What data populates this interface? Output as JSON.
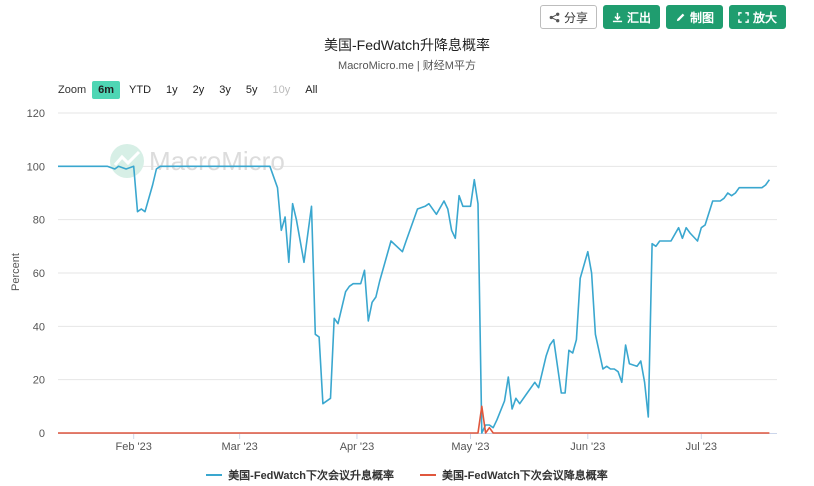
{
  "toolbar": {
    "buttons": [
      {
        "label": "分享",
        "icon": "share-icon"
      },
      {
        "label": "汇出",
        "icon": "download-icon"
      },
      {
        "label": "制图",
        "icon": "pencil-icon"
      },
      {
        "label": "放大",
        "icon": "expand-icon"
      }
    ]
  },
  "zoom": {
    "label": "Zoom",
    "options": [
      "6m",
      "YTD",
      "1y",
      "2y",
      "3y",
      "5y",
      "10y",
      "All"
    ],
    "selected": "6m",
    "disabled": [
      "10y"
    ]
  },
  "watermark": "MacroMicro",
  "colors": {
    "series1": "#3aa7cf",
    "series2": "#e0573d",
    "accent": "#1f9d6f",
    "zoom_active": "#4fd6b4"
  },
  "chart_data": {
    "type": "line",
    "title": "美国-FedWatch升降息概率",
    "subtitle": "MacroMicro.me | 财经M平方",
    "ylabel": "Percent",
    "xlabel": "",
    "ylim": [
      0,
      120
    ],
    "yticks": [
      0,
      20,
      40,
      60,
      80,
      100,
      120
    ],
    "xlim": [
      "2023-01-12",
      "2023-07-21"
    ],
    "xticks": [
      {
        "date": "2023-02-01",
        "label": "Feb '23"
      },
      {
        "date": "2023-03-01",
        "label": "Mar '23"
      },
      {
        "date": "2023-04-01",
        "label": "Apr '23"
      },
      {
        "date": "2023-05-01",
        "label": "May '23"
      },
      {
        "date": "2023-06-01",
        "label": "Jun '23"
      },
      {
        "date": "2023-07-01",
        "label": "Jul '23"
      }
    ],
    "grid": true,
    "legend_position": "bottom",
    "series": [
      {
        "name": "美国-FedWatch下次会议升息概率",
        "color": "#3aa7cf",
        "points": [
          [
            "2023-01-12",
            100
          ],
          [
            "2023-01-25",
            100
          ],
          [
            "2023-01-27",
            99
          ],
          [
            "2023-01-28",
            100
          ],
          [
            "2023-01-30",
            99
          ],
          [
            "2023-02-01",
            100
          ],
          [
            "2023-02-02",
            83
          ],
          [
            "2023-02-03",
            84
          ],
          [
            "2023-02-04",
            83
          ],
          [
            "2023-02-06",
            93
          ],
          [
            "2023-02-07",
            99
          ],
          [
            "2023-02-08",
            100
          ],
          [
            "2023-03-01",
            100
          ],
          [
            "2023-03-09",
            100
          ],
          [
            "2023-03-11",
            92
          ],
          [
            "2023-03-12",
            76
          ],
          [
            "2023-03-13",
            81
          ],
          [
            "2023-03-14",
            64
          ],
          [
            "2023-03-15",
            86
          ],
          [
            "2023-03-16",
            80
          ],
          [
            "2023-03-18",
            64
          ],
          [
            "2023-03-20",
            85
          ],
          [
            "2023-03-21",
            37
          ],
          [
            "2023-03-22",
            36
          ],
          [
            "2023-03-23",
            11
          ],
          [
            "2023-03-25",
            13
          ],
          [
            "2023-03-26",
            43
          ],
          [
            "2023-03-27",
            41
          ],
          [
            "2023-03-29",
            53
          ],
          [
            "2023-03-30",
            55
          ],
          [
            "2023-03-31",
            56
          ],
          [
            "2023-04-02",
            56
          ],
          [
            "2023-04-03",
            61
          ],
          [
            "2023-04-04",
            42
          ],
          [
            "2023-04-05",
            49
          ],
          [
            "2023-04-06",
            51
          ],
          [
            "2023-04-07",
            57
          ],
          [
            "2023-04-10",
            72
          ],
          [
            "2023-04-13",
            68
          ],
          [
            "2023-04-14",
            72
          ],
          [
            "2023-04-17",
            84
          ],
          [
            "2023-04-19",
            85
          ],
          [
            "2023-04-20",
            86
          ],
          [
            "2023-04-22",
            82
          ],
          [
            "2023-04-24",
            87
          ],
          [
            "2023-04-25",
            84
          ],
          [
            "2023-04-26",
            76
          ],
          [
            "2023-04-27",
            73
          ],
          [
            "2023-04-28",
            89
          ],
          [
            "2023-04-29",
            85
          ],
          [
            "2023-05-01",
            85
          ],
          [
            "2023-05-02",
            95
          ],
          [
            "2023-05-03",
            86
          ],
          [
            "2023-05-04",
            0
          ],
          [
            "2023-05-05",
            3
          ],
          [
            "2023-05-06",
            3
          ],
          [
            "2023-05-07",
            2
          ],
          [
            "2023-05-08",
            5
          ],
          [
            "2023-05-10",
            12
          ],
          [
            "2023-05-11",
            21
          ],
          [
            "2023-05-12",
            9
          ],
          [
            "2023-05-13",
            13
          ],
          [
            "2023-05-14",
            11
          ],
          [
            "2023-05-16",
            15
          ],
          [
            "2023-05-18",
            19
          ],
          [
            "2023-05-19",
            17
          ],
          [
            "2023-05-21",
            29
          ],
          [
            "2023-05-22",
            33
          ],
          [
            "2023-05-23",
            35
          ],
          [
            "2023-05-25",
            15
          ],
          [
            "2023-05-26",
            15
          ],
          [
            "2023-05-27",
            31
          ],
          [
            "2023-05-28",
            30
          ],
          [
            "2023-05-29",
            35
          ],
          [
            "2023-05-30",
            58
          ],
          [
            "2023-06-01",
            68
          ],
          [
            "2023-06-02",
            60
          ],
          [
            "2023-06-03",
            37
          ],
          [
            "2023-06-05",
            24
          ],
          [
            "2023-06-06",
            25
          ],
          [
            "2023-06-07",
            24
          ],
          [
            "2023-06-08",
            24
          ],
          [
            "2023-06-09",
            23
          ],
          [
            "2023-06-10",
            19
          ],
          [
            "2023-06-11",
            33
          ],
          [
            "2023-06-12",
            26
          ],
          [
            "2023-06-14",
            25
          ],
          [
            "2023-06-15",
            27
          ],
          [
            "2023-06-16",
            19
          ],
          [
            "2023-06-17",
            6
          ],
          [
            "2023-06-18",
            71
          ],
          [
            "2023-06-19",
            70
          ],
          [
            "2023-06-20",
            72
          ],
          [
            "2023-06-23",
            72
          ],
          [
            "2023-06-25",
            77
          ],
          [
            "2023-06-26",
            73
          ],
          [
            "2023-06-27",
            77
          ],
          [
            "2023-06-28",
            75
          ],
          [
            "2023-06-30",
            72
          ],
          [
            "2023-07-01",
            77
          ],
          [
            "2023-07-02",
            78
          ],
          [
            "2023-07-04",
            87
          ],
          [
            "2023-07-05",
            87
          ],
          [
            "2023-07-06",
            87
          ],
          [
            "2023-07-07",
            88
          ],
          [
            "2023-07-08",
            90
          ],
          [
            "2023-07-09",
            89
          ],
          [
            "2023-07-10",
            90
          ],
          [
            "2023-07-11",
            92
          ],
          [
            "2023-07-14",
            92
          ],
          [
            "2023-07-17",
            92
          ],
          [
            "2023-07-18",
            93
          ],
          [
            "2023-07-19",
            95
          ]
        ]
      },
      {
        "name": "美国-FedWatch下次会议降息概率",
        "color": "#e0573d",
        "points": [
          [
            "2023-01-12",
            0
          ],
          [
            "2023-05-03",
            0
          ],
          [
            "2023-05-04",
            10
          ],
          [
            "2023-05-05",
            0
          ],
          [
            "2023-05-06",
            2
          ],
          [
            "2023-05-07",
            0
          ],
          [
            "2023-07-19",
            0
          ]
        ]
      }
    ]
  }
}
